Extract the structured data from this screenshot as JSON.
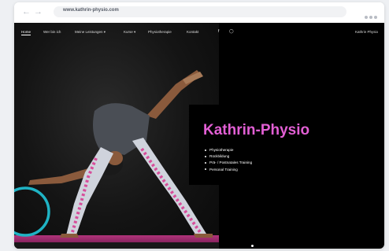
{
  "browser": {
    "url": "www.kathrin-physio.com"
  },
  "nav": {
    "items": [
      {
        "label": "Home",
        "active": true
      },
      {
        "label": "Wer bin ich"
      },
      {
        "label": "Meine Leistungen",
        "has_dropdown": true
      },
      {
        "label": "Kurse",
        "has_dropdown": true
      },
      {
        "label": "Physiotherapie"
      },
      {
        "label": "Kontakt"
      }
    ],
    "social_icons": [
      "facebook-icon",
      "instagram-icon"
    ],
    "brand": "Kathrin Physio"
  },
  "hero": {
    "headline": "Kathrin-Physio",
    "services": [
      "Physiotherapie",
      "Rückbildung",
      "Prä- / Postnatales Training",
      "Personal Training"
    ]
  },
  "colors": {
    "accent": "#e25fd4",
    "background": "#000000",
    "mat": "#b0347a",
    "ring": "#1fb3c4"
  }
}
